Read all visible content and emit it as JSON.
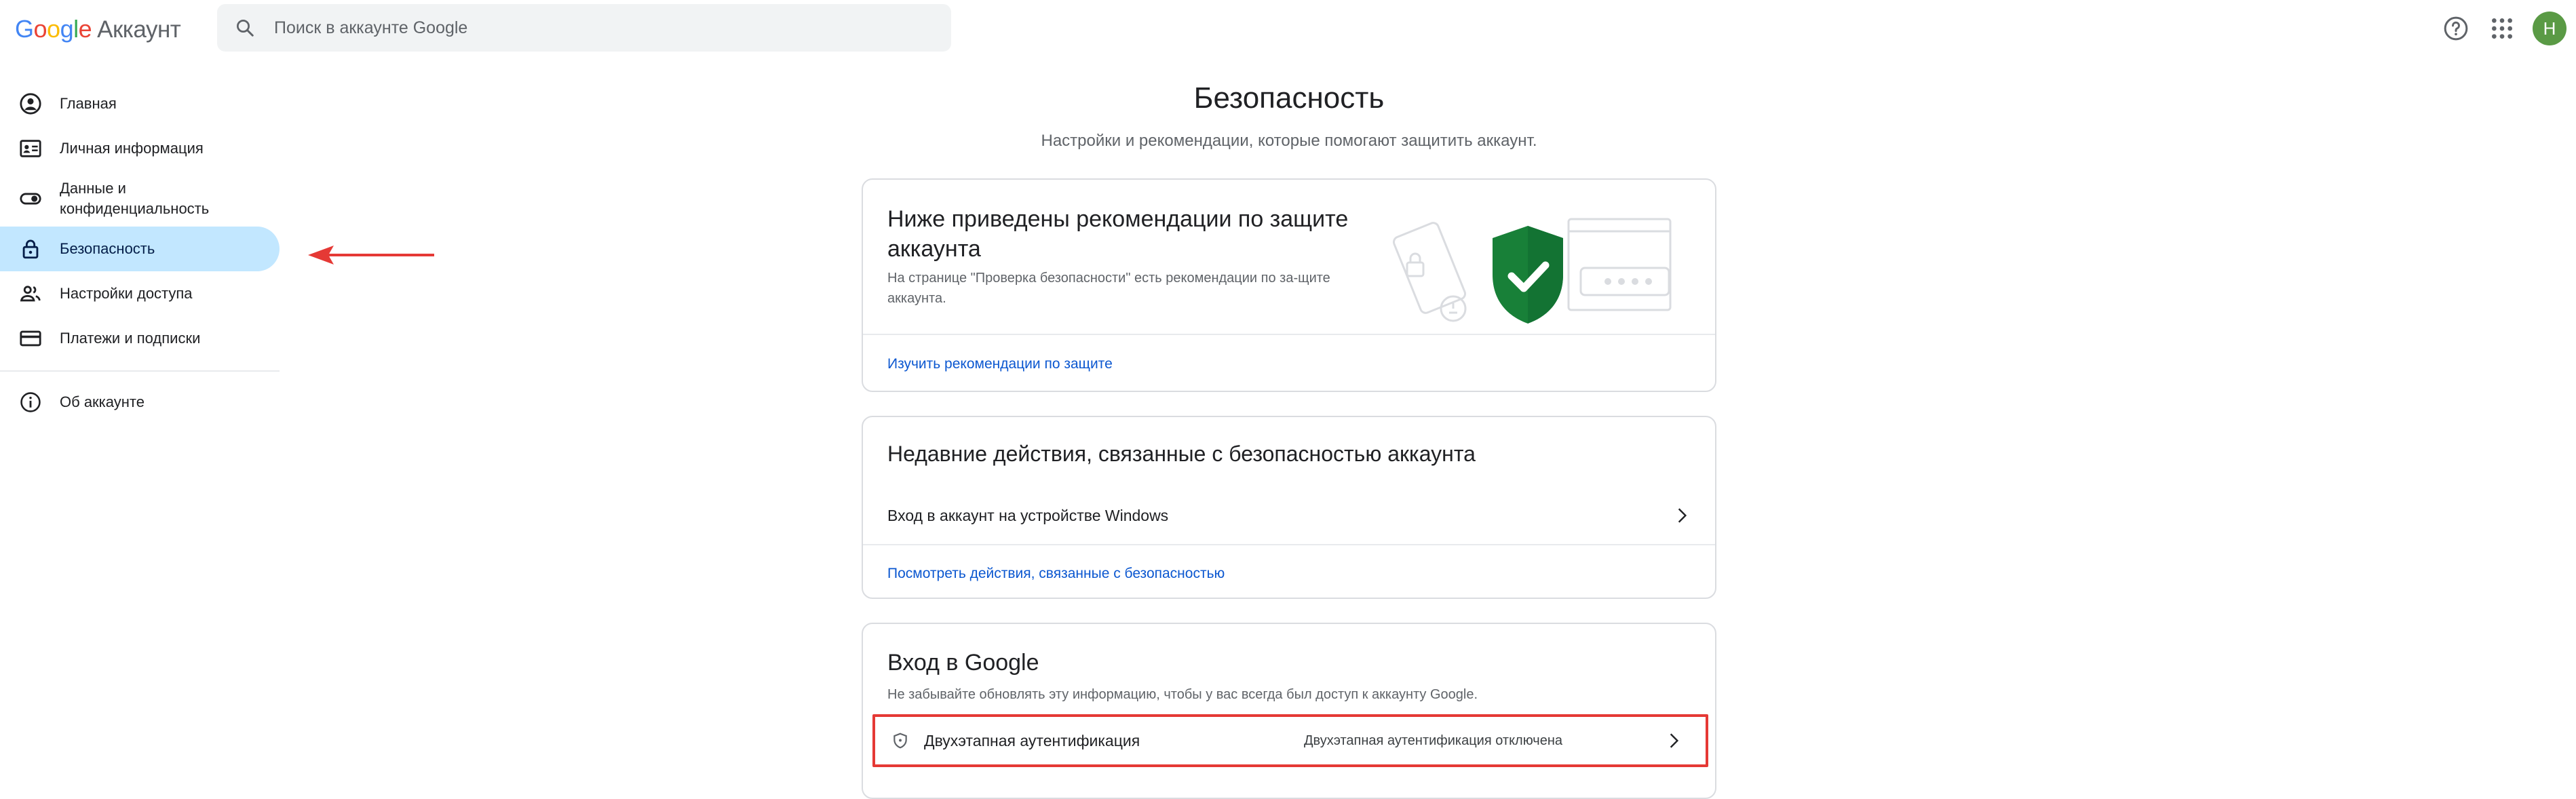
{
  "header": {
    "logo_google": "Google",
    "logo_product": "Аккаунт",
    "search_placeholder": "Поиск в аккаунте Google",
    "avatar_letter": "H",
    "icons": [
      "search-icon",
      "help-icon",
      "apps-icon"
    ]
  },
  "sidebar": {
    "items": [
      {
        "label": "Главная",
        "icon": "account-circle-icon"
      },
      {
        "label": "Личная информация",
        "icon": "id-card-icon"
      },
      {
        "label": "Данные и конфиденциальность",
        "icon": "toggle-icon"
      },
      {
        "label": "Безопасность",
        "icon": "lock-icon",
        "active": true
      },
      {
        "label": "Настройки доступа",
        "icon": "people-icon"
      },
      {
        "label": "Платежи и подписки",
        "icon": "credit-card-icon"
      }
    ],
    "about_label": "Об аккаунте",
    "about_icon": "info-icon"
  },
  "main": {
    "title": "Безопасность",
    "subtitle": "Настройки и рекомендации, которые помогают защитить аккаунт.",
    "recommendations_card": {
      "heading": "Ниже приведены рекомендации по защите аккаунта",
      "description": "На странице \"Проверка безопасности\" есть рекомендации по за-щите аккаунта.",
      "link": "Изучить рекомендации по защите"
    },
    "recent_activity_card": {
      "heading": "Недавние действия, связанные с безопасностью аккаунта",
      "item": "Вход в аккаунт на устройстве Windows",
      "link": "Посмотреть действия, связанные с безопасностью"
    },
    "signin_card": {
      "heading": "Вход в Google",
      "description": "Не забывайте обновлять эту информацию, чтобы у вас всегда был доступ к аккаунту Google.",
      "two_step_label": "Двухэтапная аутентификация",
      "two_step_status": "Двухэтапная аутентификация отключена"
    }
  },
  "colors": {
    "active_nav_bg": "#c2e7ff",
    "link": "#0b57d0",
    "annotation_red": "#e53935",
    "shield_green": "#188038",
    "avatar_bg": "#5a9a45"
  }
}
